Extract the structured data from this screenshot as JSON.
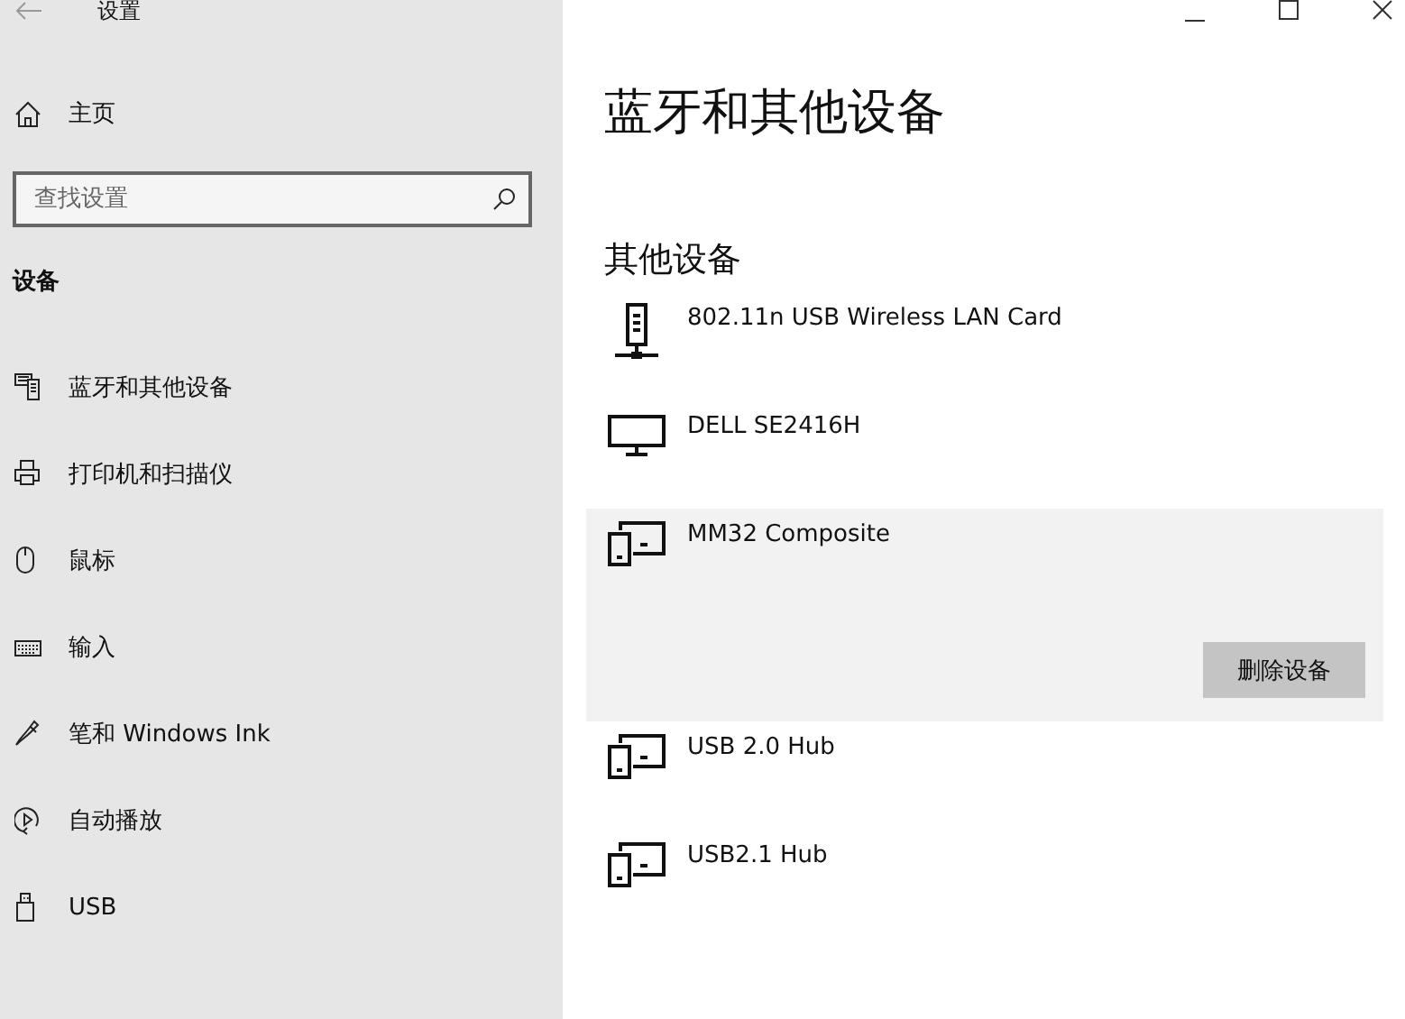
{
  "window": {
    "title": "设置"
  },
  "sidebar": {
    "home": "主页",
    "search": {
      "placeholder": "查找设置"
    },
    "section": "设备",
    "items": [
      {
        "label": "蓝牙和其他设备",
        "kind": "bluetooth"
      },
      {
        "label": "打印机和扫描仪",
        "kind": "printer"
      },
      {
        "label": "鼠标",
        "kind": "mouse"
      },
      {
        "label": "输入",
        "kind": "keyboard"
      },
      {
        "label": "笔和 Windows Ink",
        "kind": "pen"
      },
      {
        "label": "自动播放",
        "kind": "autoplay"
      },
      {
        "label": "USB",
        "kind": "usb"
      }
    ]
  },
  "main": {
    "title": "蓝牙和其他设备",
    "section": "其他设备",
    "devices": [
      {
        "name": "802.11n USB Wireless LAN Card",
        "kind": "network",
        "selected": false
      },
      {
        "name": "DELL SE2416H",
        "kind": "monitor",
        "selected": false
      },
      {
        "name": "MM32 Composite",
        "kind": "generic",
        "selected": true,
        "action": "删除设备"
      },
      {
        "name": "USB 2.0 Hub",
        "kind": "generic",
        "selected": false
      },
      {
        "name": "USB2.1 Hub",
        "kind": "generic",
        "selected": false
      }
    ]
  }
}
